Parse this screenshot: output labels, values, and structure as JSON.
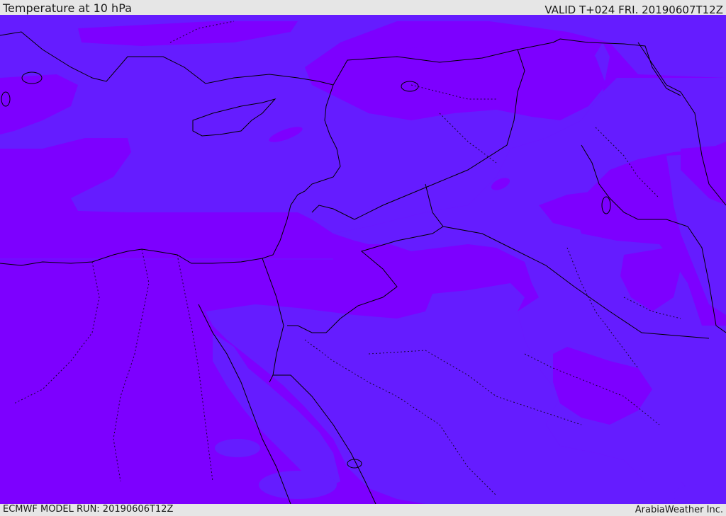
{
  "header": {
    "title": "Temperature at 10 hPa",
    "valid": "VALID T+024 FRI. 20190607T12Z"
  },
  "footer": {
    "model_run": "ECMWF MODEL RUN: 20190606T12Z",
    "credit": "ArabiaWeather Inc."
  },
  "map": {
    "colors": {
      "cold_band": "#7d00ff",
      "warm_band": "#651cff",
      "border": "#000000"
    }
  }
}
